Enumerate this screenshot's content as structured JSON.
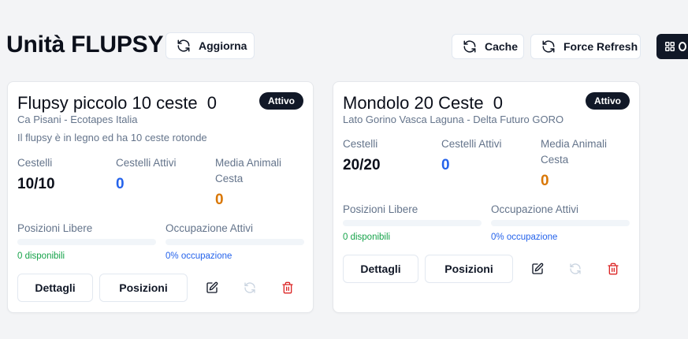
{
  "header": {
    "title": "Unità FLUPSY",
    "refresh_label": "Aggiorna",
    "cache_label": "Cache",
    "force_refresh_label": "Force Refresh"
  },
  "cards": [
    {
      "title": "Flupsy piccolo 10 ceste",
      "count": "0",
      "status": "Attivo",
      "location": "Ca Pisani - Ecotapes Italia",
      "description": "Il flupsy è in legno ed ha 10 ceste rotonde",
      "stats": {
        "cestelli_label": "Cestelli",
        "cestelli_value": "10/10",
        "attivi_label": "Cestelli Attivi",
        "attivi_value": "0",
        "media_label_1": "Media Animali",
        "media_label_2": "Cesta",
        "media_value": "0"
      },
      "positions": {
        "free_label": "Posizioni Libere",
        "free_fraction": 0,
        "free_note": "0 disponibili",
        "occupancy_label": "Occupazione Attivi",
        "occupancy_fraction": 0,
        "occupancy_note": "0% occupazione"
      },
      "actions": {
        "details": "Dettagli",
        "positions": "Posizioni"
      }
    },
    {
      "title": "Mondolo 20 Ceste",
      "count": "0",
      "status": "Attivo",
      "location": "Lato Gorino Vasca Laguna - Delta Futuro GORO",
      "description": "",
      "stats": {
        "cestelli_label": "Cestelli",
        "cestelli_value": "20/20",
        "attivi_label": "Cestelli Attivi",
        "attivi_value": "0",
        "media_label_1": "Media Animali",
        "media_label_2": "Cesta",
        "media_value": "0"
      },
      "positions": {
        "free_label": "Posizioni Libere",
        "free_fraction": 0,
        "free_note": "0 disponibili",
        "occupancy_label": "Occupazione Attivi",
        "occupancy_fraction": 0,
        "occupancy_note": "0% occupazione"
      },
      "actions": {
        "details": "Dettagli",
        "positions": "Posizioni"
      }
    }
  ],
  "icons": {
    "refresh": "refresh-icon",
    "grid": "grid-icon",
    "edit": "edit-icon",
    "sync": "sync-icon",
    "delete": "trash-icon"
  },
  "colors": {
    "primary": "#111827",
    "blue": "#2563eb",
    "orange": "#d97706",
    "green": "#16a34a",
    "danger": "#dc2626"
  }
}
